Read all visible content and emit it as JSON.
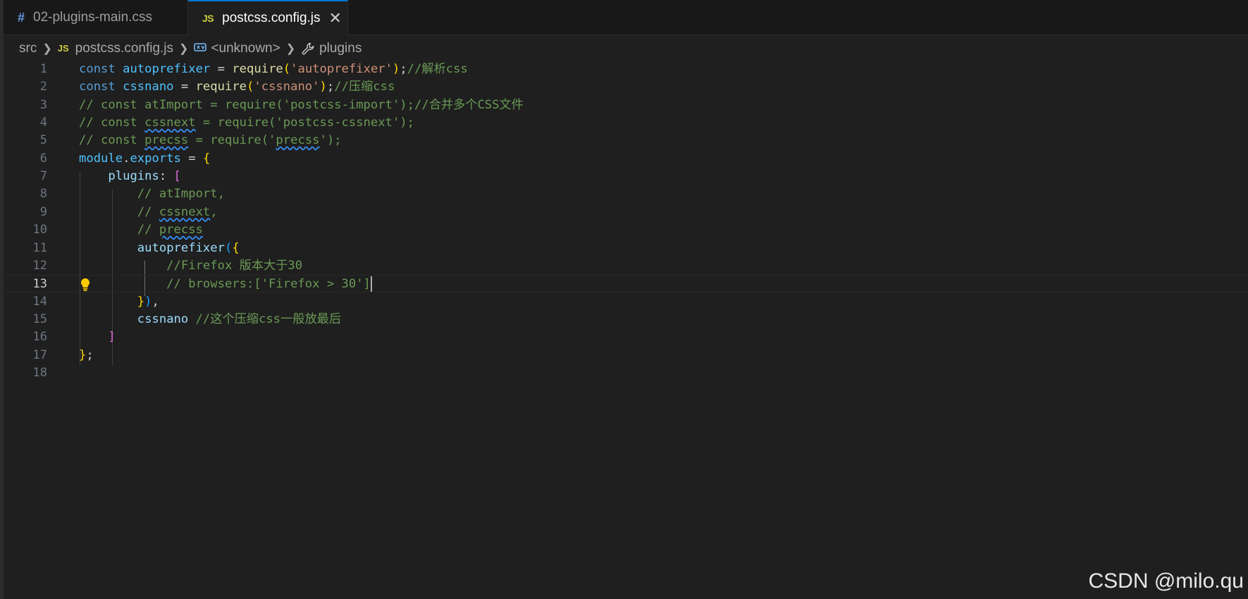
{
  "tabs": [
    {
      "label": "02-plugins-main.css",
      "icon": "#",
      "active": false
    },
    {
      "label": "postcss.config.js",
      "icon": "JS",
      "active": true,
      "close": "✕"
    }
  ],
  "breadcrumb": {
    "root": "src",
    "file_icon": "JS",
    "file": "postcss.config.js",
    "symbol": "<unknown>",
    "property": "plugins"
  },
  "editor": {
    "current_line": 13,
    "line_numbers": [
      "1",
      "2",
      "3",
      "4",
      "5",
      "6",
      "7",
      "8",
      "9",
      "10",
      "11",
      "12",
      "13",
      "14",
      "15",
      "16",
      "17",
      "18"
    ],
    "lines": [
      [
        {
          "t": "const ",
          "c": "kw"
        },
        {
          "t": "autoprefixer",
          "c": "var"
        },
        {
          "t": " = ",
          "c": "op"
        },
        {
          "t": "require",
          "c": "fn dotted-start"
        },
        {
          "t": "(",
          "c": "b1"
        },
        {
          "t": "'autoprefixer'",
          "c": "str"
        },
        {
          "t": ")",
          "c": "b1"
        },
        {
          "t": ";",
          "c": "op"
        },
        {
          "t": "//解析css",
          "c": "cmt"
        }
      ],
      [
        {
          "t": "const ",
          "c": "kw"
        },
        {
          "t": "cssnano",
          "c": "var"
        },
        {
          "t": " = ",
          "c": "op"
        },
        {
          "t": "require",
          "c": "fn"
        },
        {
          "t": "(",
          "c": "b1"
        },
        {
          "t": "'cssnano'",
          "c": "str"
        },
        {
          "t": ")",
          "c": "b1"
        },
        {
          "t": ";",
          "c": "op"
        },
        {
          "t": "//压缩css",
          "c": "cmt"
        }
      ],
      [
        {
          "t": "// const atImport = require('postcss-import');//合并多个CSS文件",
          "c": "cmt"
        }
      ],
      [
        {
          "t": "// const ",
          "c": "cmt"
        },
        {
          "t": "cssnext",
          "c": "cmt wavy"
        },
        {
          "t": " = require('postcss-cssnext');",
          "c": "cmt"
        }
      ],
      [
        {
          "t": "// const ",
          "c": "cmt"
        },
        {
          "t": "precss",
          "c": "cmt wavy"
        },
        {
          "t": " = require('",
          "c": "cmt"
        },
        {
          "t": "precss",
          "c": "cmt wavy"
        },
        {
          "t": "');",
          "c": "cmt"
        }
      ],
      [
        {
          "t": "module",
          "c": "var"
        },
        {
          "t": ".",
          "c": "op"
        },
        {
          "t": "exports",
          "c": "var"
        },
        {
          "t": " = ",
          "c": "op"
        },
        {
          "t": "{",
          "c": "b1"
        }
      ],
      [
        {
          "t": "    ",
          "c": "op"
        },
        {
          "t": "plugins",
          "c": "prop"
        },
        {
          "t": ": ",
          "c": "op"
        },
        {
          "t": "[",
          "c": "b2"
        }
      ],
      [
        {
          "t": "        // atImport,",
          "c": "cmt"
        }
      ],
      [
        {
          "t": "        // ",
          "c": "cmt"
        },
        {
          "t": "cssnext",
          "c": "cmt wavy"
        },
        {
          "t": ",",
          "c": "cmt"
        }
      ],
      [
        {
          "t": "        // ",
          "c": "cmt"
        },
        {
          "t": "precss",
          "c": "cmt wavy"
        }
      ],
      [
        {
          "t": "        ",
          "c": "op"
        },
        {
          "t": "autoprefixer",
          "c": "prop"
        },
        {
          "t": "(",
          "c": "b3"
        },
        {
          "t": "{",
          "c": "b1"
        }
      ],
      [
        {
          "t": "            //Firefox 版本大于30",
          "c": "cmt"
        }
      ],
      [
        {
          "t": "            // browsers:['Firefox > 30']",
          "c": "cmt"
        }
      ],
      [
        {
          "t": "        ",
          "c": "op"
        },
        {
          "t": "}",
          "c": "b1"
        },
        {
          "t": ")",
          "c": "b3"
        },
        {
          "t": ",",
          "c": "op"
        }
      ],
      [
        {
          "t": "        ",
          "c": "op"
        },
        {
          "t": "cssnano",
          "c": "prop"
        },
        {
          "t": " //这个压缩css一般放最后",
          "c": "cmt"
        }
      ],
      [
        {
          "t": "    ",
          "c": "op"
        },
        {
          "t": "]",
          "c": "b2"
        }
      ],
      [
        {
          "t": "}",
          "c": "b1"
        },
        {
          "t": ";",
          "c": "op"
        }
      ],
      []
    ]
  },
  "watermark": "CSDN @milo.qu"
}
